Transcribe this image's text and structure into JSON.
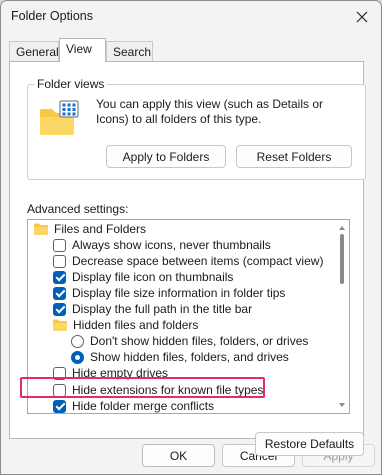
{
  "window": {
    "title": "Folder Options"
  },
  "tabs": [
    {
      "label": "General",
      "active": false
    },
    {
      "label": "View",
      "active": true
    },
    {
      "label": "Search",
      "active": false
    }
  ],
  "folder_views": {
    "group_label": "Folder views",
    "description": "You can apply this view (such as Details or Icons) to all folders of this type.",
    "apply_button": "Apply to Folders",
    "reset_button": "Reset Folders"
  },
  "advanced": {
    "label": "Advanced settings:",
    "items": [
      {
        "type": "folder",
        "label": "Files and Folders"
      },
      {
        "type": "checkbox",
        "label": "Always show icons, never thumbnails",
        "checked": false
      },
      {
        "type": "checkbox",
        "label": "Decrease space between items (compact view)",
        "checked": false
      },
      {
        "type": "checkbox",
        "label": "Display file icon on thumbnails",
        "checked": true
      },
      {
        "type": "checkbox",
        "label": "Display file size information in folder tips",
        "checked": true
      },
      {
        "type": "checkbox",
        "label": "Display the full path in the title bar",
        "checked": true
      },
      {
        "type": "folder",
        "label": "Hidden files and folders"
      },
      {
        "type": "radio",
        "label": "Don't show hidden files, folders, or drives",
        "checked": false
      },
      {
        "type": "radio",
        "label": "Show hidden files, folders, and drives",
        "checked": true
      },
      {
        "type": "checkbox",
        "label": "Hide empty drives",
        "checked": false
      },
      {
        "type": "checkbox",
        "label": "Hide extensions for known file types",
        "checked": false
      },
      {
        "type": "checkbox",
        "label": "Hide folder merge conflicts",
        "checked": true
      }
    ]
  },
  "buttons": {
    "restore_defaults": "Restore Defaults",
    "ok": "OK",
    "cancel": "Cancel",
    "apply": "Apply"
  },
  "colors": {
    "accent": "#005fb8",
    "highlight_outline": "#e62b6c",
    "folder_yellow": "#f7c948"
  }
}
